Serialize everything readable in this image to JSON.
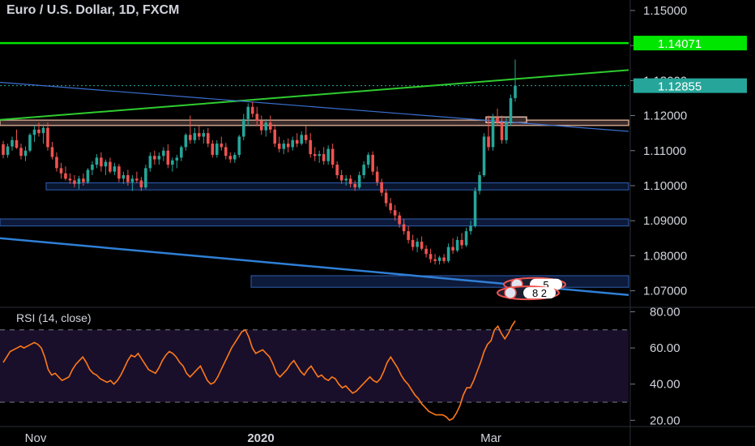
{
  "chart_data": [
    {
      "type": "candlestick",
      "title": "Euro / U.S. Dollar, 1D, FXCM",
      "ylim": [
        1.0655,
        1.153
      ],
      "yticks": [
        "1.15000",
        "1.14000",
        "1.13000",
        "1.12000",
        "1.11000",
        "1.10000",
        "1.09000",
        "1.08000",
        "1.07000"
      ],
      "price_labels": [
        {
          "value": "1.14071",
          "price": 1.14071,
          "color": "#00e600"
        },
        {
          "value": "1.12855",
          "price": 1.12855,
          "color": "#26a69a"
        }
      ],
      "xticks": [
        "Nov",
        "2020",
        "Mar"
      ],
      "colors": {
        "up": "#26a69a",
        "down": "#ef5350",
        "level_green": "#00e600",
        "trend_blue": "#2f7fd6",
        "zone_blue": "#1b2a5a"
      },
      "candles": [
        [
          1.1118,
          1.1128,
          1.1078,
          1.1088
        ],
        [
          1.1088,
          1.112,
          1.108,
          1.1112
        ],
        [
          1.1112,
          1.114,
          1.11,
          1.113
        ],
        [
          1.113,
          1.116,
          1.1105,
          1.1108
        ],
        [
          1.1108,
          1.112,
          1.1075,
          1.1085
        ],
        [
          1.1085,
          1.1112,
          1.107,
          1.11
        ],
        [
          1.11,
          1.115,
          1.1095,
          1.1145
        ],
        [
          1.1145,
          1.1172,
          1.1125,
          1.116
        ],
        [
          1.116,
          1.118,
          1.114,
          1.115
        ],
        [
          1.115,
          1.1175,
          1.112,
          1.1165
        ],
        [
          1.1165,
          1.118,
          1.11,
          1.111
        ],
        [
          1.111,
          1.1125,
          1.1075,
          1.1082
        ],
        [
          1.1082,
          1.1095,
          1.104,
          1.105
        ],
        [
          1.105,
          1.1065,
          1.102,
          1.1035
        ],
        [
          1.1035,
          1.1055,
          1.1015,
          1.102
        ],
        [
          1.102,
          1.1035,
          1.1005,
          1.1015
        ],
        [
          1.1015,
          1.103,
          1.0995,
          1.1005
        ],
        [
          1.1005,
          1.1028,
          1.099,
          1.102
        ],
        [
          1.102,
          1.1035,
          1.1,
          1.101
        ],
        [
          1.101,
          1.105,
          1.1005,
          1.1045
        ],
        [
          1.1045,
          1.107,
          1.103,
          1.106
        ],
        [
          1.106,
          1.109,
          1.105,
          1.108
        ],
        [
          1.108,
          1.1095,
          1.104,
          1.1055
        ],
        [
          1.1055,
          1.1075,
          1.103,
          1.1068
        ],
        [
          1.1068,
          1.108,
          1.1035,
          1.104
        ],
        [
          1.104,
          1.1065,
          1.103,
          1.1055
        ],
        [
          1.1055,
          1.1062,
          1.101,
          1.102
        ],
        [
          1.102,
          1.104,
          1.1005,
          1.103
        ],
        [
          1.103,
          1.1045,
          1.1,
          1.101
        ],
        [
          1.101,
          1.103,
          1.0985,
          1.102
        ],
        [
          1.102,
          1.104,
          1.1008,
          1.1015
        ],
        [
          1.1015,
          1.1025,
          1.0985,
          1.0995
        ],
        [
          1.0995,
          1.106,
          1.099,
          1.105
        ],
        [
          1.105,
          1.1095,
          1.104,
          1.1085
        ],
        [
          1.1085,
          1.11,
          1.106,
          1.1075
        ],
        [
          1.1075,
          1.1095,
          1.106,
          1.1085
        ],
        [
          1.1085,
          1.111,
          1.107,
          1.11
        ],
        [
          1.11,
          1.1118,
          1.105,
          1.106
        ],
        [
          1.106,
          1.108,
          1.104,
          1.1072
        ],
        [
          1.1072,
          1.1088,
          1.105,
          1.108
        ],
        [
          1.108,
          1.1115,
          1.107,
          1.111
        ],
        [
          1.111,
          1.115,
          1.11,
          1.1145
        ],
        [
          1.1145,
          1.12,
          1.112,
          1.113
        ],
        [
          1.113,
          1.1165,
          1.112,
          1.115
        ],
        [
          1.115,
          1.1172,
          1.113,
          1.114
        ],
        [
          1.114,
          1.116,
          1.112,
          1.115
        ],
        [
          1.115,
          1.1165,
          1.111,
          1.112
        ],
        [
          1.112,
          1.113,
          1.108,
          1.1088
        ],
        [
          1.1088,
          1.113,
          1.108,
          1.112
        ],
        [
          1.112,
          1.114,
          1.11,
          1.111
        ],
        [
          1.111,
          1.1122,
          1.1075,
          1.1085
        ],
        [
          1.1085,
          1.1095,
          1.1065,
          1.1075
        ],
        [
          1.1075,
          1.1095,
          1.1065,
          1.1088
        ],
        [
          1.1088,
          1.1145,
          1.108,
          1.114
        ],
        [
          1.114,
          1.1205,
          1.113,
          1.119
        ],
        [
          1.119,
          1.1235,
          1.117,
          1.1225
        ],
        [
          1.1225,
          1.124,
          1.1195,
          1.1205
        ],
        [
          1.1205,
          1.1225,
          1.117,
          1.1185
        ],
        [
          1.1185,
          1.12,
          1.1145,
          1.1158
        ],
        [
          1.1158,
          1.119,
          1.114,
          1.118
        ],
        [
          1.118,
          1.12,
          1.115,
          1.116
        ],
        [
          1.116,
          1.1175,
          1.111,
          1.112
        ],
        [
          1.112,
          1.114,
          1.1095,
          1.1105
        ],
        [
          1.1105,
          1.113,
          1.109,
          1.112
        ],
        [
          1.112,
          1.1135,
          1.1095,
          1.111
        ],
        [
          1.111,
          1.114,
          1.11,
          1.113
        ],
        [
          1.113,
          1.115,
          1.111,
          1.112
        ],
        [
          1.112,
          1.1155,
          1.1115,
          1.1145
        ],
        [
          1.1145,
          1.117,
          1.112,
          1.113
        ],
        [
          1.113,
          1.115,
          1.108,
          1.109
        ],
        [
          1.109,
          1.111,
          1.107,
          1.1085
        ],
        [
          1.1085,
          1.11,
          1.1065,
          1.109
        ],
        [
          1.109,
          1.111,
          1.106,
          1.107
        ],
        [
          1.107,
          1.1115,
          1.106,
          1.1105
        ],
        [
          1.1105,
          1.112,
          1.105,
          1.106
        ],
        [
          1.106,
          1.107,
          1.102,
          1.103
        ],
        [
          1.103,
          1.1045,
          1.1005,
          1.1015
        ],
        [
          1.1015,
          1.103,
          1.1,
          1.102
        ],
        [
          1.102,
          1.103,
          1.0995,
          1.1005
        ],
        [
          1.1005,
          1.1015,
          1.0985,
          1.0995
        ],
        [
          1.0995,
          1.104,
          1.099,
          1.103
        ],
        [
          1.103,
          1.107,
          1.102,
          1.106
        ],
        [
          1.106,
          1.1095,
          1.105,
          1.1088
        ],
        [
          1.1088,
          1.1098,
          1.103,
          1.104
        ],
        [
          1.104,
          1.1055,
          1.1,
          1.101
        ],
        [
          1.101,
          1.102,
          1.097,
          1.098
        ],
        [
          1.098,
          1.099,
          1.094,
          1.095
        ],
        [
          1.095,
          1.0965,
          1.092,
          1.093
        ],
        [
          1.093,
          1.0945,
          1.09,
          1.0915
        ],
        [
          1.0915,
          1.0925,
          1.088,
          1.089
        ],
        [
          1.089,
          1.0905,
          1.086,
          1.087
        ],
        [
          1.087,
          1.0885,
          1.0835,
          1.0845
        ],
        [
          1.0845,
          1.086,
          1.0815,
          1.0825
        ],
        [
          1.0825,
          1.085,
          1.081,
          1.084
        ],
        [
          1.084,
          1.0855,
          1.0815,
          1.082
        ],
        [
          1.082,
          1.083,
          1.0795,
          1.0805
        ],
        [
          1.0805,
          1.082,
          1.078,
          1.079
        ],
        [
          1.079,
          1.0805,
          1.0775,
          1.0785
        ],
        [
          1.0785,
          1.08,
          1.0775,
          1.0795
        ],
        [
          1.0795,
          1.0805,
          1.0778,
          1.0785
        ],
        [
          1.0785,
          1.0835,
          1.078,
          1.0825
        ],
        [
          1.0825,
          1.085,
          1.0805,
          1.0815
        ],
        [
          1.0815,
          1.0855,
          1.081,
          1.0845
        ],
        [
          1.0845,
          1.0865,
          1.082,
          1.083
        ],
        [
          1.083,
          1.088,
          1.0825,
          1.087
        ],
        [
          1.087,
          1.09,
          1.086,
          1.0885
        ],
        [
          1.0885,
          1.0995,
          1.088,
          1.0985
        ],
        [
          1.0985,
          1.104,
          1.0975,
          1.103
        ],
        [
          1.103,
          1.115,
          1.1025,
          1.114
        ],
        [
          1.114,
          1.12,
          1.11,
          1.111
        ],
        [
          1.111,
          1.1205,
          1.11,
          1.1195
        ],
        [
          1.1195,
          1.122,
          1.117,
          1.118
        ],
        [
          1.118,
          1.12,
          1.112,
          1.113
        ],
        [
          1.113,
          1.1195,
          1.112,
          1.118
        ],
        [
          1.118,
          1.126,
          1.117,
          1.125
        ],
        [
          1.125,
          1.136,
          1.124,
          1.1285
        ]
      ],
      "annotations": [
        {
          "label": "5",
          "price": 1.0718
        },
        {
          "label": "8 2",
          "price": 1.0694
        }
      ]
    },
    {
      "type": "line",
      "title": "RSI (14, close)",
      "ylim": [
        17,
        82
      ],
      "yticks": [
        "80.00",
        "60.00",
        "40.00",
        "20.00"
      ],
      "band": [
        30,
        70
      ],
      "values": [
        52,
        55,
        58,
        59,
        60,
        61,
        60,
        61,
        62,
        63,
        62,
        60,
        55,
        48,
        45,
        46,
        44,
        42,
        43,
        44,
        48,
        51,
        53,
        55,
        52,
        48,
        46,
        45,
        43,
        42,
        41,
        42,
        40,
        42,
        45,
        49,
        53,
        56,
        55,
        57,
        54,
        51,
        48,
        47,
        46,
        49,
        53,
        56,
        58,
        57,
        55,
        52,
        50,
        46,
        44,
        46,
        48,
        50,
        46,
        42,
        40,
        41,
        44,
        48,
        52,
        56,
        60,
        63,
        66,
        69,
        70,
        66,
        60,
        57,
        58,
        59,
        57,
        55,
        51,
        46,
        44,
        46,
        48,
        51,
        53,
        50,
        47,
        45,
        48,
        50,
        47,
        44,
        45,
        43,
        42,
        44,
        43,
        40,
        38,
        39,
        37,
        35,
        36,
        38,
        40,
        42,
        44,
        42,
        41,
        43,
        47,
        52,
        55,
        52,
        49,
        45,
        42,
        40,
        37,
        34,
        32,
        29,
        27,
        25,
        24,
        23,
        23,
        23,
        22,
        20,
        21,
        24,
        28,
        34,
        38,
        38,
        42,
        47,
        52,
        58,
        62,
        64,
        70,
        72,
        68,
        65,
        68,
        72,
        75
      ]
    }
  ]
}
